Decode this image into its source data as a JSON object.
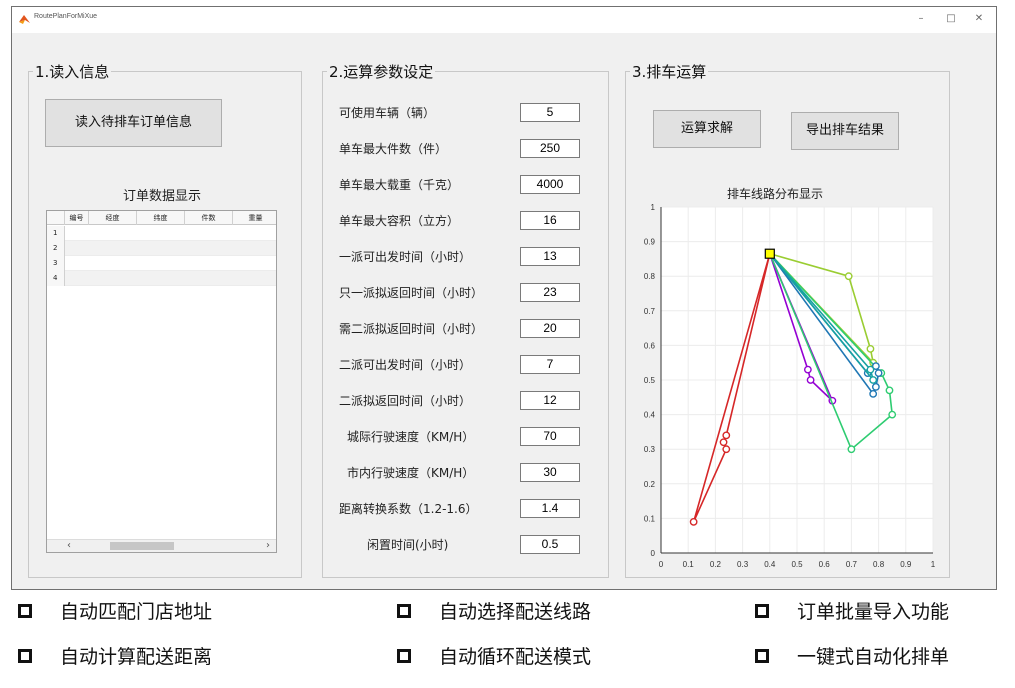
{
  "window": {
    "title": "RoutePlanForMiXue",
    "minimize": "–",
    "maximize": "□",
    "close": "✕"
  },
  "panel1": {
    "title": "1.读入信息",
    "read_button": "读入待排车订单信息",
    "table_title": "订单数据显示",
    "columns": [
      "编号",
      "经度",
      "纬度",
      "件数",
      "重量"
    ],
    "rows": [
      "1",
      "2",
      "3",
      "4"
    ],
    "scroll_left": "‹",
    "scroll_right": "›"
  },
  "panel2": {
    "title": "2.运算参数设定",
    "params": [
      {
        "label": "可使用车辆（辆）",
        "value": "5"
      },
      {
        "label": "单车最大件数（件）",
        "value": "250"
      },
      {
        "label": "单车最大载重（千克）",
        "value": "4000"
      },
      {
        "label": "单车最大容积（立方）",
        "value": "16"
      },
      {
        "label": "一派可出发时间（小时）",
        "value": "13"
      },
      {
        "label": "只一派拟返回时间（小时）",
        "value": "23"
      },
      {
        "label": "需二派拟返回时间（小时）",
        "value": "20"
      },
      {
        "label": "二派可出发时间（小时）",
        "value": "7"
      },
      {
        "label": "二派拟返回时间（小时）",
        "value": "12"
      },
      {
        "label": "城际行驶速度（KM/H）",
        "value": "70"
      },
      {
        "label": "市内行驶速度（KM/H）",
        "value": "30"
      },
      {
        "label": "距离转换系数（1.2-1.6）",
        "value": "1.4"
      },
      {
        "label": "闲置时间(小时)",
        "value": "0.5"
      }
    ]
  },
  "panel3": {
    "title": "3.排车运算",
    "solve_button": "运算求解",
    "export_button": "导出排车结果",
    "chart_title": "排车线路分布显示"
  },
  "chart_data": {
    "type": "line",
    "title": "排车线路分布显示",
    "xlim": [
      0,
      1
    ],
    "ylim": [
      0,
      1
    ],
    "xticks": [
      "0",
      "0.1",
      "0.2",
      "0.3",
      "0.4",
      "0.5",
      "0.6",
      "0.7",
      "0.8",
      "0.9",
      "1"
    ],
    "yticks": [
      "0",
      "0.1",
      "0.2",
      "0.3",
      "0.4",
      "0.5",
      "0.6",
      "0.7",
      "0.8",
      "0.9",
      "1"
    ],
    "grid": true,
    "depot": {
      "x": 0.4,
      "y": 0.865,
      "color": "#ffff00"
    },
    "series": [
      {
        "color": "#d62728",
        "x": [
          0.4,
          0.12,
          0.24,
          0.23,
          0.24,
          0.4
        ],
        "y": [
          0.865,
          0.09,
          0.3,
          0.32,
          0.34,
          0.865
        ]
      },
      {
        "color": "#9400d3",
        "x": [
          0.4,
          0.54,
          0.55,
          0.63,
          0.4
        ],
        "y": [
          0.865,
          0.53,
          0.5,
          0.44,
          0.865
        ]
      },
      {
        "color": "#9acd32",
        "x": [
          0.4,
          0.69,
          0.77,
          0.78,
          0.4
        ],
        "y": [
          0.865,
          0.8,
          0.59,
          0.55,
          0.865
        ]
      },
      {
        "color": "#2ecc71",
        "x": [
          0.4,
          0.81,
          0.84,
          0.85,
          0.7,
          0.4
        ],
        "y": [
          0.865,
          0.52,
          0.47,
          0.4,
          0.3,
          0.865
        ]
      },
      {
        "color": "#1f77b4",
        "x": [
          0.4,
          0.76,
          0.79,
          0.8,
          0.79,
          0.78,
          0.4
        ],
        "y": [
          0.865,
          0.52,
          0.54,
          0.52,
          0.48,
          0.46,
          0.865
        ]
      },
      {
        "color": "#17a2a2",
        "x": [
          0.4,
          0.78,
          0.77,
          0.4
        ],
        "y": [
          0.865,
          0.5,
          0.53,
          0.865
        ]
      }
    ]
  },
  "features": [
    "自动匹配门店地址",
    "自动选择配送线路",
    "订单批量导入功能",
    "自动计算配送距离",
    "自动循环配送模式",
    "一键式自动化排单"
  ]
}
